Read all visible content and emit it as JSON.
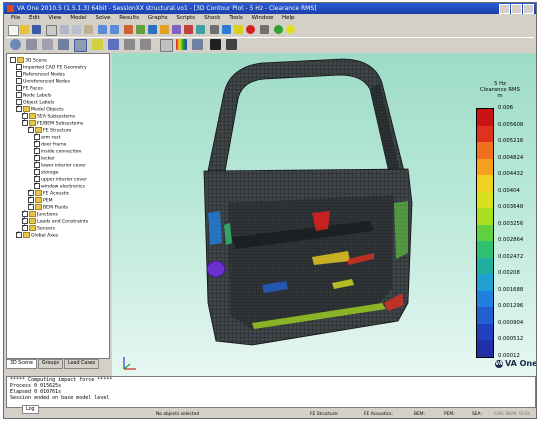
{
  "window": {
    "title": "VA One 2010.5 (1.5.1.3) 64bit - SessionXX structural.vo1 - [3D Contour Plot - 5 Hz - Clearance RMS]"
  },
  "menu": [
    "File",
    "Edit",
    "View",
    "Model",
    "Solve",
    "Results",
    "Graphs",
    "Scripts",
    "Shock",
    "Tools",
    "Window",
    "Help"
  ],
  "tree": {
    "items": [
      {
        "label": "3D Scene",
        "level": 0,
        "checked": false
      },
      {
        "label": "Imported CAD FE Geometry",
        "level": 1,
        "checked": false
      },
      {
        "label": "Referenced Nodes",
        "level": 1,
        "checked": false
      },
      {
        "label": "Unreferenced Nodes",
        "level": 1,
        "checked": false
      },
      {
        "label": "FE Faces",
        "level": 1,
        "checked": false
      },
      {
        "label": "Node Labels",
        "level": 1,
        "checked": false
      },
      {
        "label": "Object Labels",
        "level": 1,
        "checked": false
      },
      {
        "label": "Model Objects",
        "level": 1,
        "checked": true
      },
      {
        "label": "SEA Subsystems",
        "level": 2,
        "checked": true
      },
      {
        "label": "FE/BEM Subsystems",
        "level": 2,
        "checked": true
      },
      {
        "label": "FE Structure",
        "level": 3,
        "checked": true
      },
      {
        "label": "arm rest",
        "level": 4,
        "checked": true
      },
      {
        "label": "door frame",
        "level": 4,
        "checked": true
      },
      {
        "label": "inside connection",
        "level": 4,
        "checked": true
      },
      {
        "label": "locker",
        "level": 4,
        "checked": true
      },
      {
        "label": "lower interior cover",
        "level": 4,
        "checked": true
      },
      {
        "label": "storage",
        "level": 4,
        "checked": true
      },
      {
        "label": "upper interior cover",
        "level": 4,
        "checked": true
      },
      {
        "label": "window electronics",
        "level": 4,
        "checked": true
      },
      {
        "label": "FE Acoustic",
        "level": 3,
        "checked": true
      },
      {
        "label": "PEM",
        "level": 3,
        "checked": true
      },
      {
        "label": "BEM Fluids",
        "level": 3,
        "checked": true
      },
      {
        "label": "Junctions",
        "level": 2,
        "checked": true
      },
      {
        "label": "Loads and Constraints",
        "level": 2,
        "checked": true
      },
      {
        "label": "Sensors",
        "level": 2,
        "checked": true
      },
      {
        "label": "Global Axes",
        "level": 1,
        "checked": true
      }
    ]
  },
  "tabs": [
    "3D Scene",
    "Groups",
    "Load Cases"
  ],
  "legend": {
    "title_line1": "5 Hz",
    "title_line2": "Clearance RMS",
    "title_line3": "m",
    "ticks": [
      "0.006",
      "0.005608",
      "0.005216",
      "0.004824",
      "0.004432",
      "0.00404",
      "0.003648",
      "0.003256",
      "0.002864",
      "0.002472",
      "0.00208",
      "0.001688",
      "0.001296",
      "0.000904",
      "0.000512",
      "0.00012"
    ],
    "colors": [
      "#c81414",
      "#e03020",
      "#f07020",
      "#f5a020",
      "#f0d020",
      "#d8e020",
      "#a8e020",
      "#60d040",
      "#30c070",
      "#20b0a0",
      "#20a0d0",
      "#2080e0",
      "#2060d0",
      "#2040c0",
      "#2030a8"
    ]
  },
  "brand": {
    "logo_text": "VA One"
  },
  "console": {
    "lines": [
      "***** Computing impact force *****",
      "Process 0 015625s",
      "Elapsed 0 010761s",
      "Session ended on base model level"
    ]
  },
  "log_tab": "Log",
  "status": {
    "selection": "No objects selected",
    "fe_structure": "FE Structure:",
    "fe_acoustics": "FE Acoustics:",
    "bem": "BEM:",
    "pem": "PEM:",
    "sea": "SEA:",
    "car": "CAR, NUM, SCRL"
  }
}
